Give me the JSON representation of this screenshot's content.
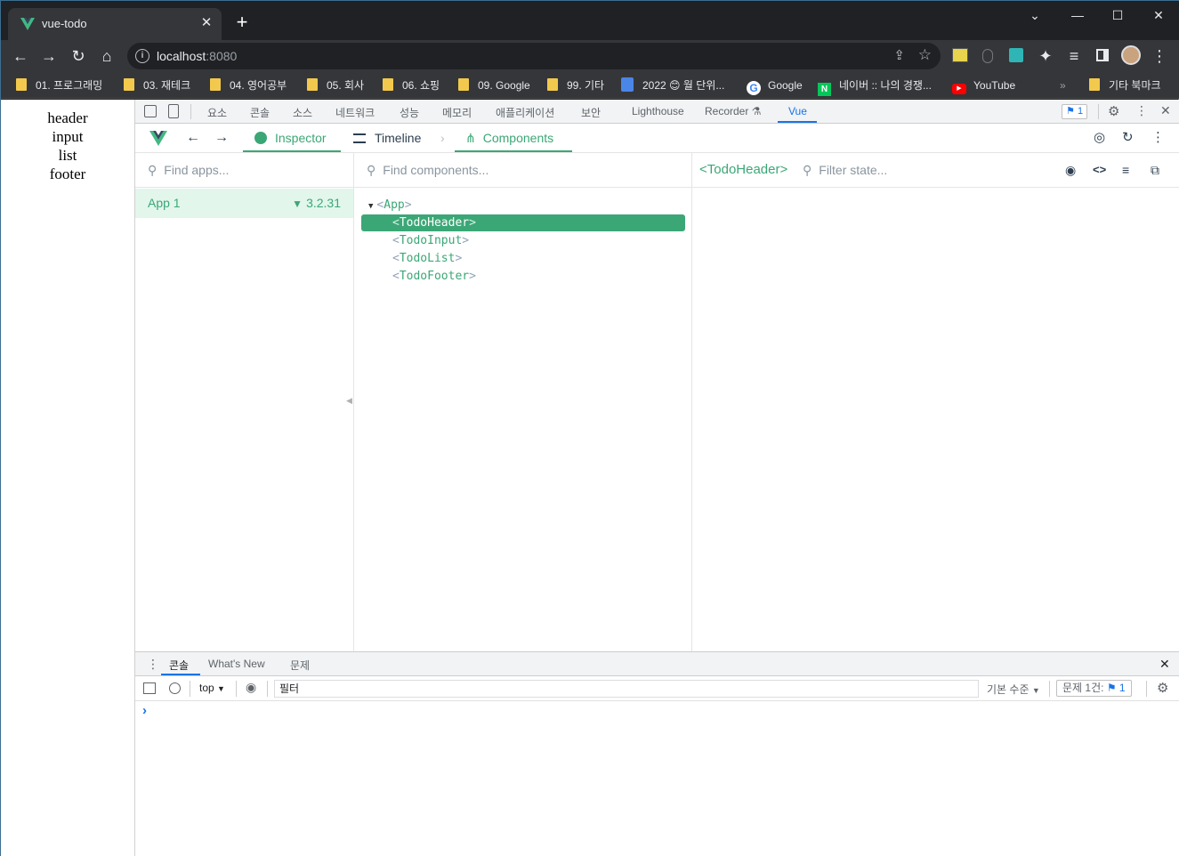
{
  "tab": {
    "title": "vue-todo",
    "close": "✕"
  },
  "window": {
    "new_tab": "+",
    "chevron": "⌄",
    "minimize": "—",
    "maximize": "☐",
    "close": "✕"
  },
  "omnibox": {
    "host": "localhost",
    "port": ":8080",
    "info": "i"
  },
  "bookmarks": [
    "01. 프로그래밍",
    "03. 재테크",
    "04. 영어공부",
    "05. 회사",
    "06. 쇼핑",
    "09. Google",
    "99. 기타",
    "2022 😊 월 단위...",
    "Google",
    "네이버 :: 나의 경쟁...",
    "YouTube"
  ],
  "bookmarks_more": "»",
  "other_bookmarks": "기타 북마크",
  "page": {
    "lines": [
      "header",
      "input",
      "list",
      "footer"
    ]
  },
  "devtools": {
    "tabs": [
      "요소",
      "콘솔",
      "소스",
      "네트워크",
      "성능",
      "메모리",
      "애플리케이션",
      "보안",
      "Lighthouse",
      "Recorder",
      "Vue"
    ],
    "issues_count": "1"
  },
  "vue": {
    "inspector": "Inspector",
    "timeline": "Timeline",
    "components": "Components",
    "find_apps": "Find apps...",
    "find_components": "Find components...",
    "filter_state": "Filter state...",
    "app_name": "App 1",
    "version": "3.2.31",
    "selected_component": "<TodoHeader>",
    "tree": {
      "root": "App",
      "children": [
        "TodoHeader",
        "TodoInput",
        "TodoList",
        "TodoFooter"
      ]
    }
  },
  "drawer": {
    "tabs": [
      "콘솔",
      "What's New",
      "문제"
    ],
    "context": "top",
    "filter": "필터",
    "level": "기본 수준",
    "issues_label": "문제 1건:",
    "issues_count": "1",
    "prompt": "›"
  },
  "colors": {
    "vue_green": "#3ba776",
    "devtools_blue": "#1a73e8",
    "chrome_dark": "#202124"
  }
}
